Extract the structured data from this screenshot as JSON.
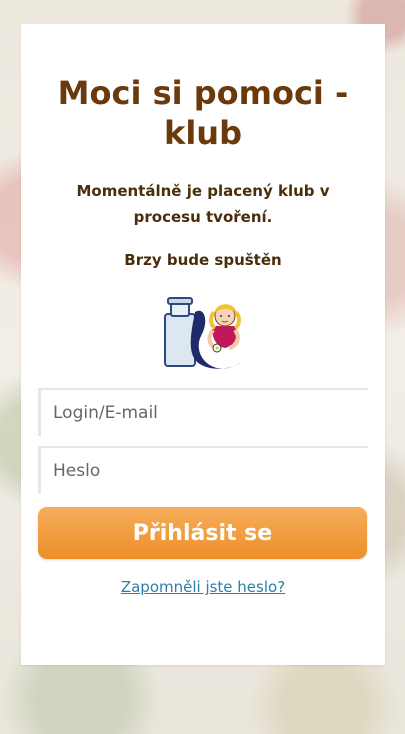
{
  "page": {
    "title": "Moci si pomoci - klub",
    "subtitle": "Momentálně je placený klub v procesu tvoření.",
    "notice": "Brzy bude spuštěn"
  },
  "login_form": {
    "login_placeholder": "Login/E-mail",
    "password_placeholder": "Heslo",
    "login_value": "",
    "password_value": "",
    "submit_label": "Přihlásit se",
    "forgot_password_label": "Zapomněli jste heslo?"
  },
  "colors": {
    "title": "#6a3a0c",
    "button_top": "#f6ad5c",
    "button_bottom": "#ed8f27",
    "link": "#2b7fa8"
  },
  "icons": {
    "illustration": "milk-can-girl-illustration"
  }
}
